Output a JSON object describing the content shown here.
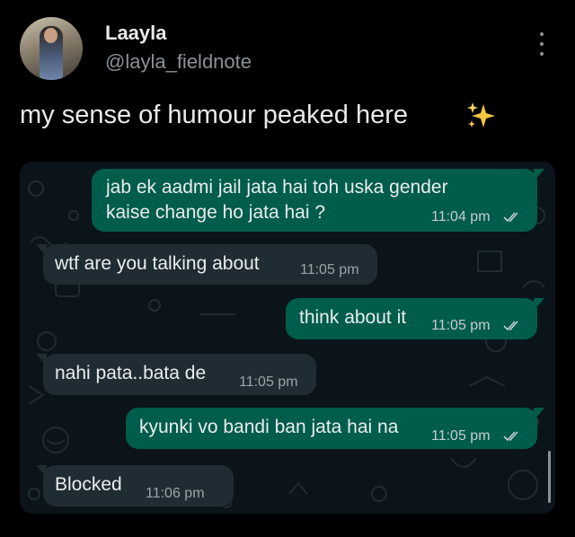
{
  "tweet": {
    "author_name": "Laayla",
    "author_handle": "@layla_fieldnote",
    "text": "my sense of humour peaked here",
    "emoji": "sparkles-icon"
  },
  "chat": {
    "messages": [
      {
        "side": "out",
        "line1": "jab ek aadmi jail jata hai toh uska gender",
        "line2": "kaise change ho jata hai ?",
        "time": "11:04 pm",
        "read": true
      },
      {
        "side": "in",
        "text": "wtf are you talking about",
        "time": "11:05 pm"
      },
      {
        "side": "out",
        "text": "think about it",
        "time": "11:05 pm",
        "read": true
      },
      {
        "side": "in",
        "text": "nahi pata..bata de",
        "time": "11:05 pm"
      },
      {
        "side": "out",
        "text": "kyunki vo bandi ban jata hai na",
        "time": "11:05 pm",
        "read": true
      },
      {
        "side": "in",
        "text": "Blocked",
        "time": "11:06 pm"
      }
    ]
  },
  "colors": {
    "background": "#000000",
    "outgoing_bubble": "#005c4b",
    "incoming_bubble": "#202c33",
    "chat_background": "#0b141a",
    "handle_text": "#8b9096"
  }
}
